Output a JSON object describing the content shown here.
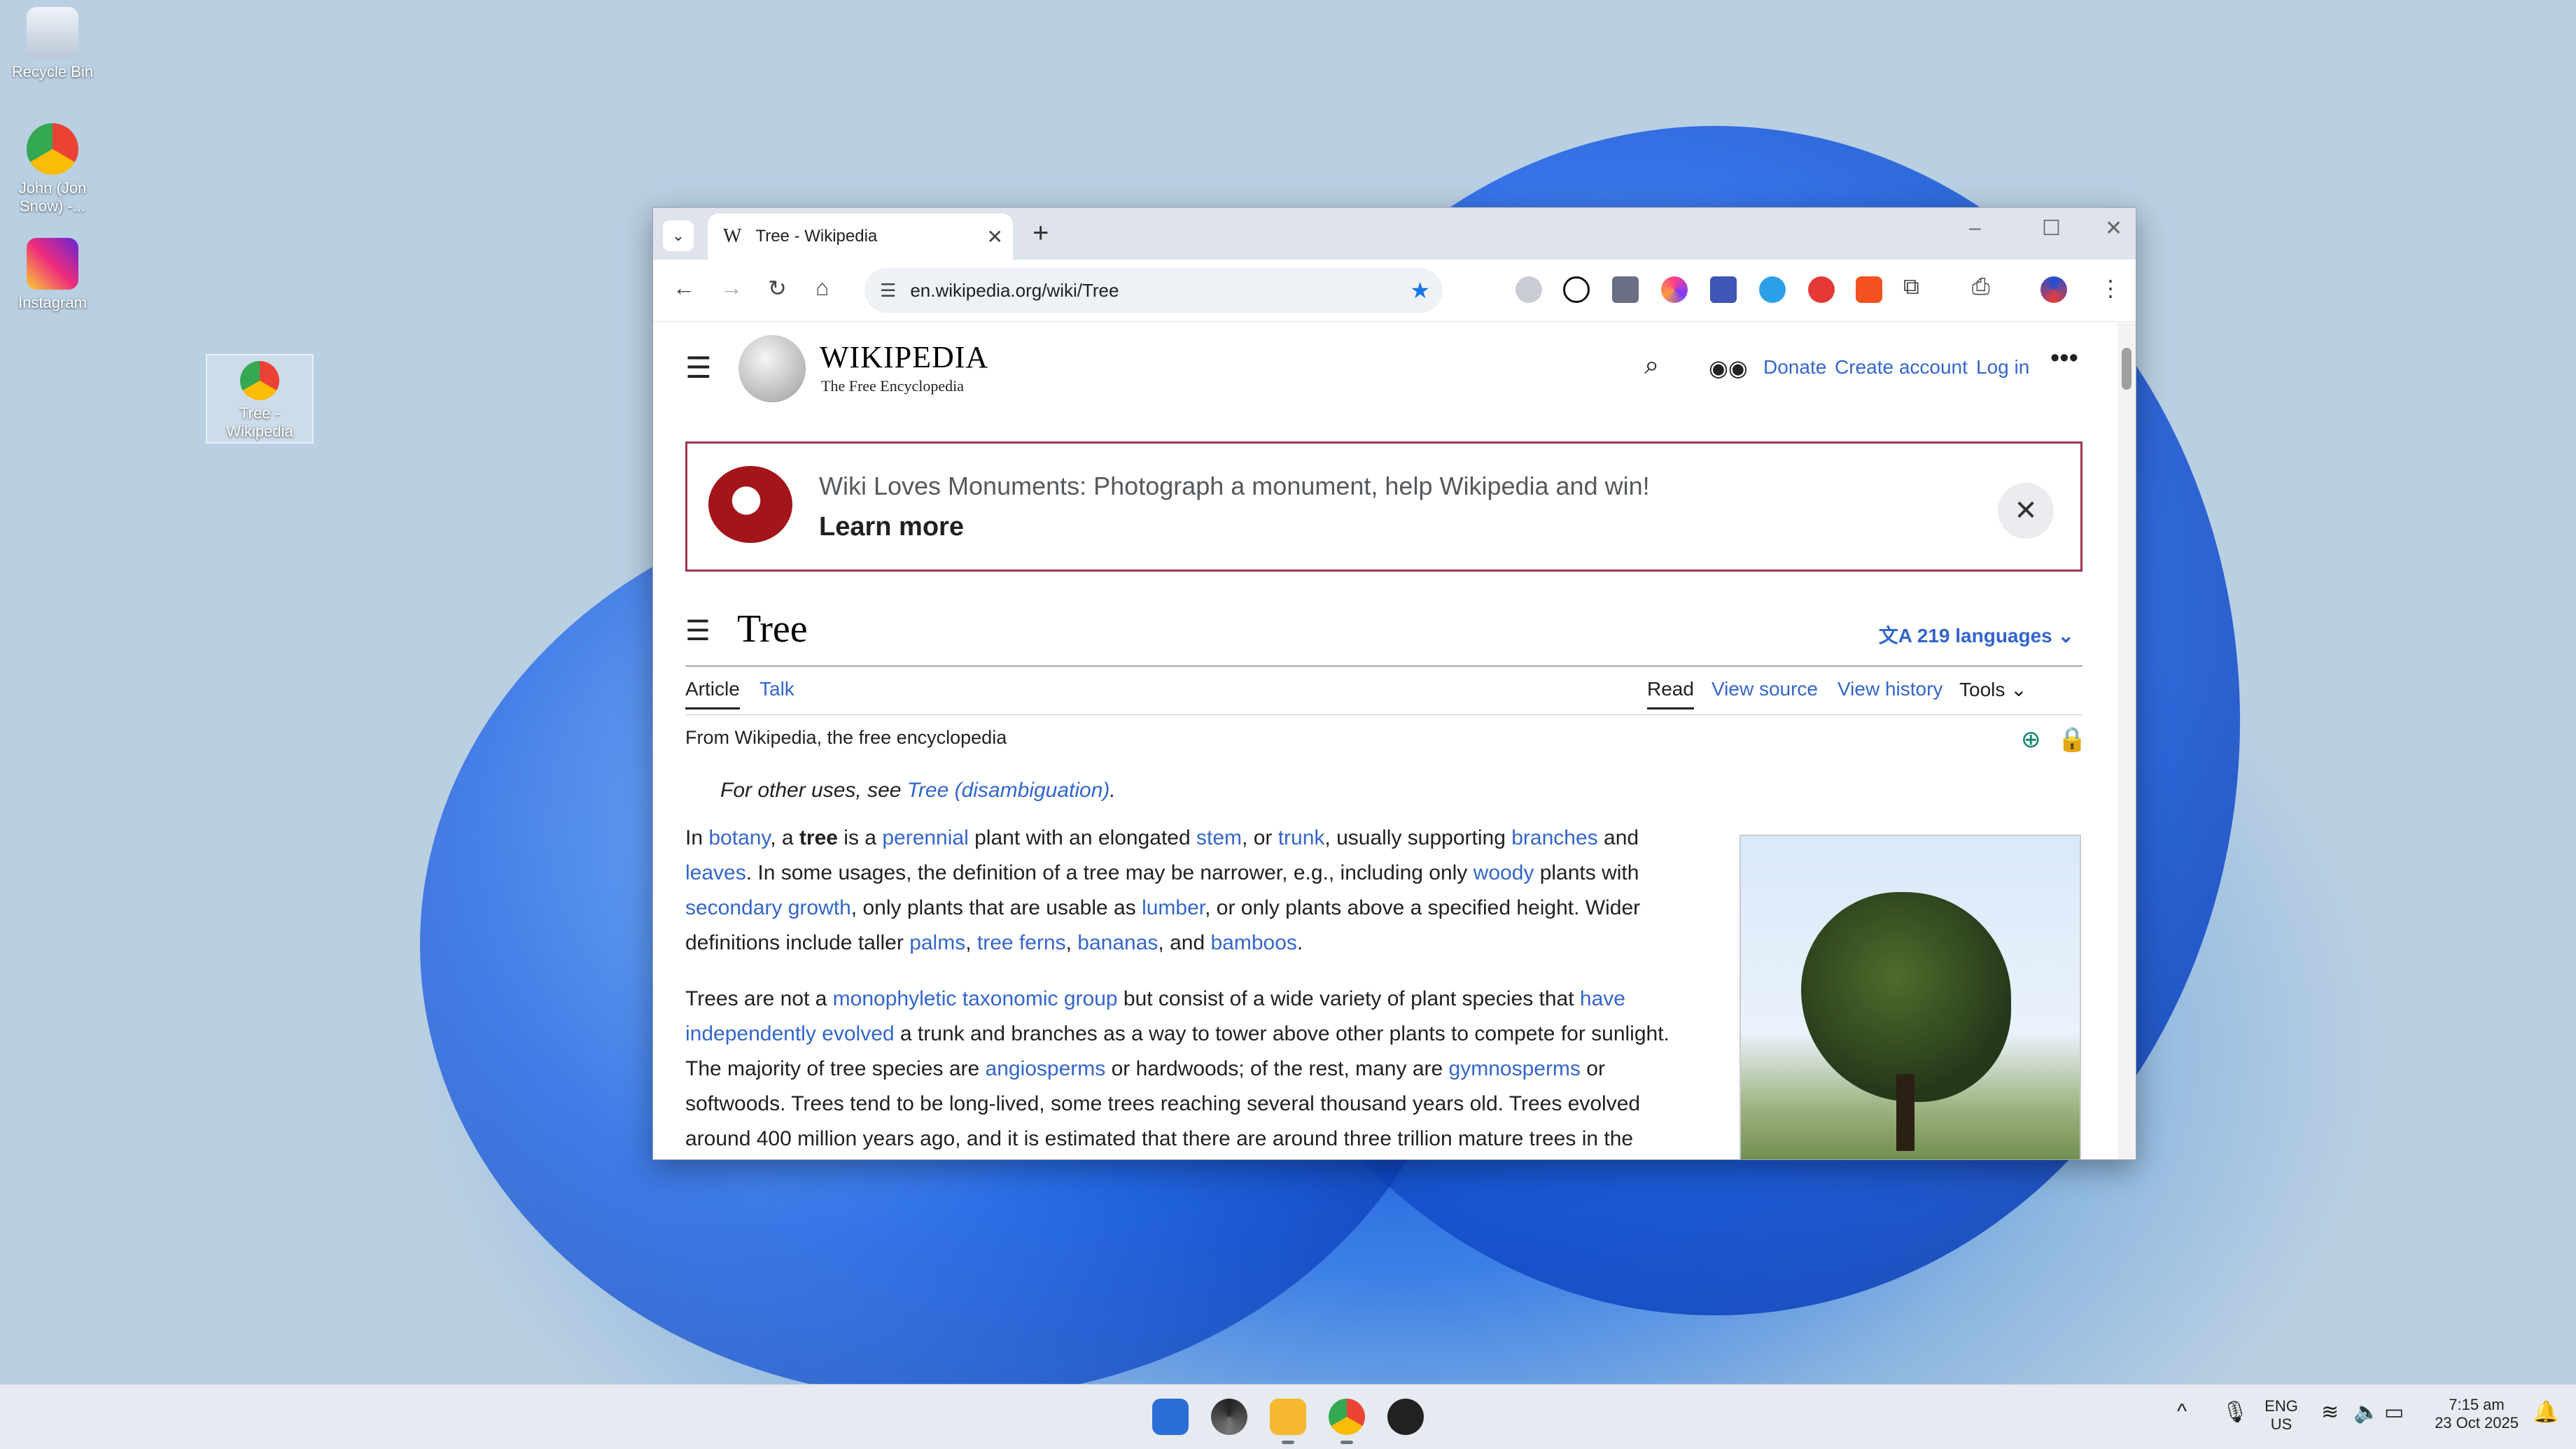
{
  "desktop": {
    "icons": [
      {
        "label": "Recycle Bin"
      },
      {
        "label": "John (Jon Snow) -..."
      },
      {
        "label": "Instagram"
      },
      {
        "label": "Tree - Wikipedia"
      }
    ]
  },
  "browser": {
    "tab_title": "Tree - Wikipedia",
    "tab_favicon": "W",
    "url": "en.wikipedia.org/wiki/Tree"
  },
  "wiki": {
    "wordmark": "WIKIPEDIA",
    "tagline": "The Free Encyclopedia",
    "header_links": {
      "donate": "Donate",
      "create_account": "Create account",
      "log_in": "Log in"
    },
    "banner": {
      "text": "Wiki Loves Monuments: Photograph a monument, help Wikipedia and win!",
      "cta": "Learn more"
    },
    "title": "Tree",
    "languages": "219 languages",
    "tabs": {
      "article": "Article",
      "talk": "Talk",
      "read": "Read",
      "view_source": "View source",
      "view_history": "View history",
      "tools": "Tools"
    },
    "from": "From Wikipedia, the free encyclopedia",
    "hatnote": {
      "prefix": "For other uses, see ",
      "link": "Tree (disambiguation)",
      "suffix": "."
    },
    "para1": [
      {
        "t": "In "
      },
      {
        "a": "botany"
      },
      {
        "t": ", a "
      },
      {
        "b": "tree"
      },
      {
        "t": " is a "
      },
      {
        "a": "perennial"
      },
      {
        "t": " plant with an elongated "
      },
      {
        "a": "stem"
      },
      {
        "t": ", or "
      },
      {
        "a": "trunk"
      },
      {
        "t": ", usually supporting "
      },
      {
        "a": "branches"
      },
      {
        "t": " and "
      },
      {
        "a": "leaves"
      },
      {
        "t": ". In some usages, the definition of a tree may be narrower, e.g., including only "
      },
      {
        "a": "woody"
      },
      {
        "t": " plants with "
      },
      {
        "a": "secondary growth"
      },
      {
        "t": ", only plants that are usable as "
      },
      {
        "a": "lumber"
      },
      {
        "t": ", or only plants above a specified height. Wider definitions include taller "
      },
      {
        "a": "palms"
      },
      {
        "t": ", "
      },
      {
        "a": "tree ferns"
      },
      {
        "t": ", "
      },
      {
        "a": "bananas"
      },
      {
        "t": ", and "
      },
      {
        "a": "bamboos"
      },
      {
        "t": "."
      }
    ],
    "para2": [
      {
        "t": "Trees are not a "
      },
      {
        "a": "monophyletic taxonomic group"
      },
      {
        "t": " but consist of a wide variety of plant species that "
      },
      {
        "a": "have independently evolved"
      },
      {
        "t": " a trunk and branches as a way to tower above other plants to compete for sunlight. The majority of tree species are "
      },
      {
        "a": "angiosperms"
      },
      {
        "t": " or hardwoods; of the rest, many are "
      },
      {
        "a": "gymnosperms"
      },
      {
        "t": " or softwoods. Trees tend to be long-lived, some trees reaching several thousand years old. Trees evolved around 400 million years ago, and it is estimated that there are around three trillion mature trees in the"
      }
    ]
  },
  "taskbar": {
    "lang": "ENG",
    "region": "US",
    "time": "7:15 am",
    "date": "23 Oct 2025"
  }
}
